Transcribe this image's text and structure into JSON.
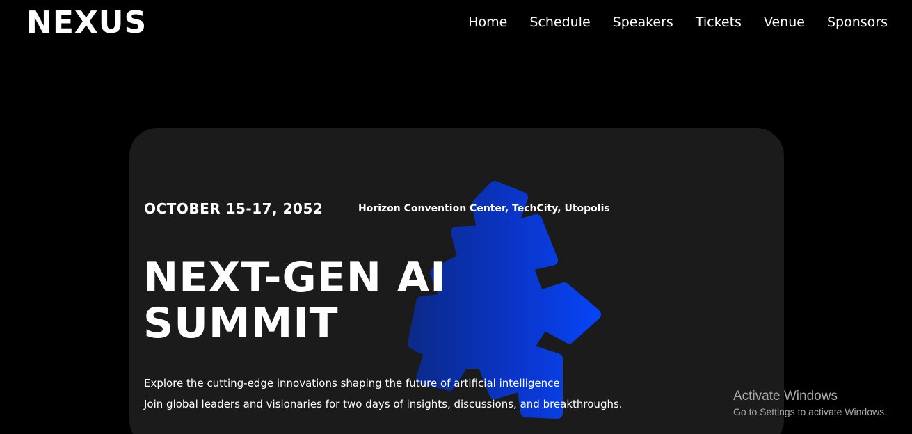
{
  "brand": {
    "logo_text": "NEXUS"
  },
  "nav": {
    "items": [
      "Home",
      "Schedule",
      "Speakers",
      "Tickets",
      "Venue",
      "Sponsors"
    ]
  },
  "hero": {
    "date": "OCTOBER 15-17, 2052",
    "venue": "Horizon Convention Center, TechCity, Utopolis",
    "title_line1": "NEXT-GEN AI",
    "title_line2": "SUMMIT",
    "description_line1": "Explore the cutting-edge innovations shaping the future of artificial intelligence",
    "description_line2": "Join global leaders and visionaries for two days of insights, discussions, and breakthroughs.",
    "graphic_icon": "star-burst-logo-icon"
  },
  "os_overlay": {
    "title": "Activate Windows",
    "subtitle": "Go to Settings to activate Windows."
  },
  "colors": {
    "background": "#000000",
    "card": "#1b1b1b",
    "accent_blue": "#0a3df0",
    "text": "#ffffff",
    "overlay_text": "#a9a9a9"
  }
}
